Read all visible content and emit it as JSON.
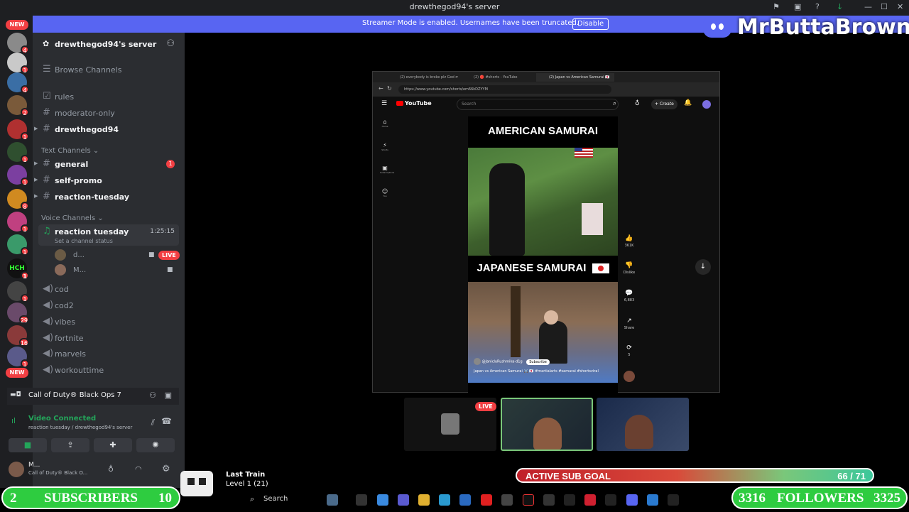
{
  "window": {
    "title": "drewthegod94's server"
  },
  "banner": {
    "text": "Streamer Mode is enabled. Usernames have been truncated.",
    "button": "Disable"
  },
  "brand": {
    "name": "MrButtaBrown"
  },
  "rail": {
    "new_top": "NEW",
    "new_bottom": "NEW",
    "badges": [
      "4",
      "1",
      "4",
      "2",
      "1",
      "1",
      "1",
      "1",
      "8",
      "1",
      "1",
      "1",
      "1",
      "1",
      "29",
      "16",
      "1"
    ]
  },
  "sidebar": {
    "server_name": "drewthegod94's server",
    "browse": "Browse Channels",
    "top_channels": [
      "rules",
      "moderator-only",
      "drewthegod94"
    ],
    "text_category": "Text Channels",
    "text_channels": [
      {
        "name": "general",
        "ping": "1"
      },
      {
        "name": "self-promo"
      },
      {
        "name": "reaction-tuesday"
      }
    ],
    "voice_category": "Voice Channels",
    "active_voice": {
      "name": "reaction tuesday",
      "time": "1:25:15",
      "status": "Set a channel status",
      "users": [
        "d...",
        "M..."
      ],
      "live": "LIVE"
    },
    "voice_channels": [
      "cod",
      "cod2",
      "vibes",
      "fortnite",
      "marvels",
      "workouttime"
    ]
  },
  "game": {
    "name": "Call of Duty® Black Ops 7"
  },
  "voice_connection": {
    "status": "Video Connected",
    "location": "reaction tuesday / drewthegod94's server"
  },
  "user_panel": {
    "name": "M...",
    "activity": "Call of Duty® Black O..."
  },
  "browser": {
    "tabs": [
      "(2) everybody is broke plz God m...",
      "(2) 🔴 #shorts - YouTube",
      "(2) Japan vs American Samurai 🇯🇵"
    ],
    "url": "https://www.youtube.com/shorts/em66kDZYYM",
    "youtube": {
      "logo": "YouTube",
      "search_placeholder": "Search",
      "create": "Create",
      "notifications": "2"
    },
    "nav": [
      {
        "icon": "⌂",
        "label": "Home"
      },
      {
        "icon": "⚡",
        "label": "Shorts"
      },
      {
        "icon": "▣",
        "label": "Subscriptions"
      },
      {
        "icon": "☺",
        "label": "You"
      }
    ],
    "short": {
      "heading1": "AMERICAN SAMURAI",
      "heading2": "JAPANESE SAMURAI",
      "channel": "@JanicluRushmika-d1g",
      "subscribe": "Subscribe",
      "caption": "Japan vs American Samurai ⚔️ 🇯🇵 #martialarts #samurai #shortsviral"
    },
    "actions": [
      {
        "icon": "👍",
        "count": "361K"
      },
      {
        "icon": "👎",
        "count": "Dislike"
      },
      {
        "icon": "💬",
        "count": "6,883"
      },
      {
        "icon": "↗",
        "count": "Share"
      },
      {
        "icon": "⟳",
        "count": "5"
      }
    ]
  },
  "cams": {
    "live": "LIVE"
  },
  "music": {
    "title": "Last Train",
    "level": "Level 1 (21)"
  },
  "sub_goal": {
    "label": "ACTIVE SUB GOAL",
    "count": "66 / 71",
    "progress": 0.93
  },
  "subscribers": {
    "left": "2",
    "label": "SUBSCRIBERS",
    "right": "10"
  },
  "followers": {
    "left": "3316",
    "label": "FOLLOWERS",
    "right": "3325"
  },
  "taskbar": {
    "search": "Search"
  },
  "colors": {
    "blurple": "#5865f2",
    "red": "#f23f43",
    "green": "#2ecc40",
    "sidebar": "#2b2d31",
    "rail": "#1e1f22"
  }
}
